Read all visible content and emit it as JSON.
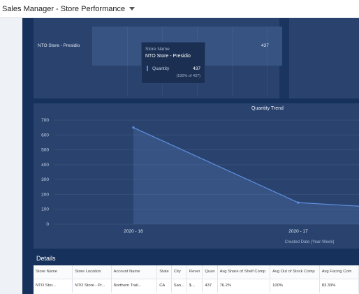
{
  "header": {
    "title": "Sales Manager - Store Performance",
    "menu_icon": "chevron-down-icon"
  },
  "store_chart": {
    "row_label": "NTO Store - Presidio",
    "row_value": "437",
    "bar_fraction": 1.0
  },
  "tooltip": {
    "store_name_label": "Store Name",
    "store_name_value": "NTO Store - Presidio",
    "quantity_label": "Quantity",
    "quantity_value": "437",
    "quantity_pct": "(100% of 437)"
  },
  "trend": {
    "title": "Quantity Trend",
    "xlabel": "Created Date (Year-Week)"
  },
  "chart_data": {
    "type": "area",
    "title": "Quantity Trend",
    "xlabel": "Created Date (Year-Week)",
    "ylabel": "",
    "categories": [
      "2020 - 16",
      "2020 - 17",
      ""
    ],
    "series": [
      {
        "values": [
          650,
          145,
          120
        ]
      }
    ],
    "ylim": [
      0,
      700
    ],
    "yticks": [
      0,
      100,
      200,
      300,
      400,
      500,
      600,
      700
    ],
    "grid": true,
    "colors": {
      "line": "#5f8fe0",
      "fill": "#3c5a8c",
      "background": "#29436e"
    }
  },
  "details": {
    "title": "Details",
    "columns": [
      "Store Name",
      "Store Location",
      "Account Name",
      "State",
      "City",
      "Revenue",
      "Quantity",
      "Avg Share of Shelf Compliance",
      "Avg Out of Stock Compliance",
      "Avg Facing Compliance"
    ],
    "header_display": [
      "Store Name",
      "Store Location",
      "Account Name",
      "State",
      "City",
      "Rever",
      "Quan",
      "Avg Share of Shelf Comp",
      "Avg Out of Stock Comp",
      "Avg Facing Com"
    ],
    "rows": [
      [
        "NTO Stor...",
        "NTO Store - Pr...",
        "Northern Trail...",
        "CA",
        "San...",
        "$...",
        "437",
        "76.2%",
        "100%",
        "83.33%"
      ]
    ]
  },
  "colors": {
    "dashboard_bg": "#16325c",
    "panel_bg": "#29436e",
    "accent": "#5f8fe0"
  }
}
